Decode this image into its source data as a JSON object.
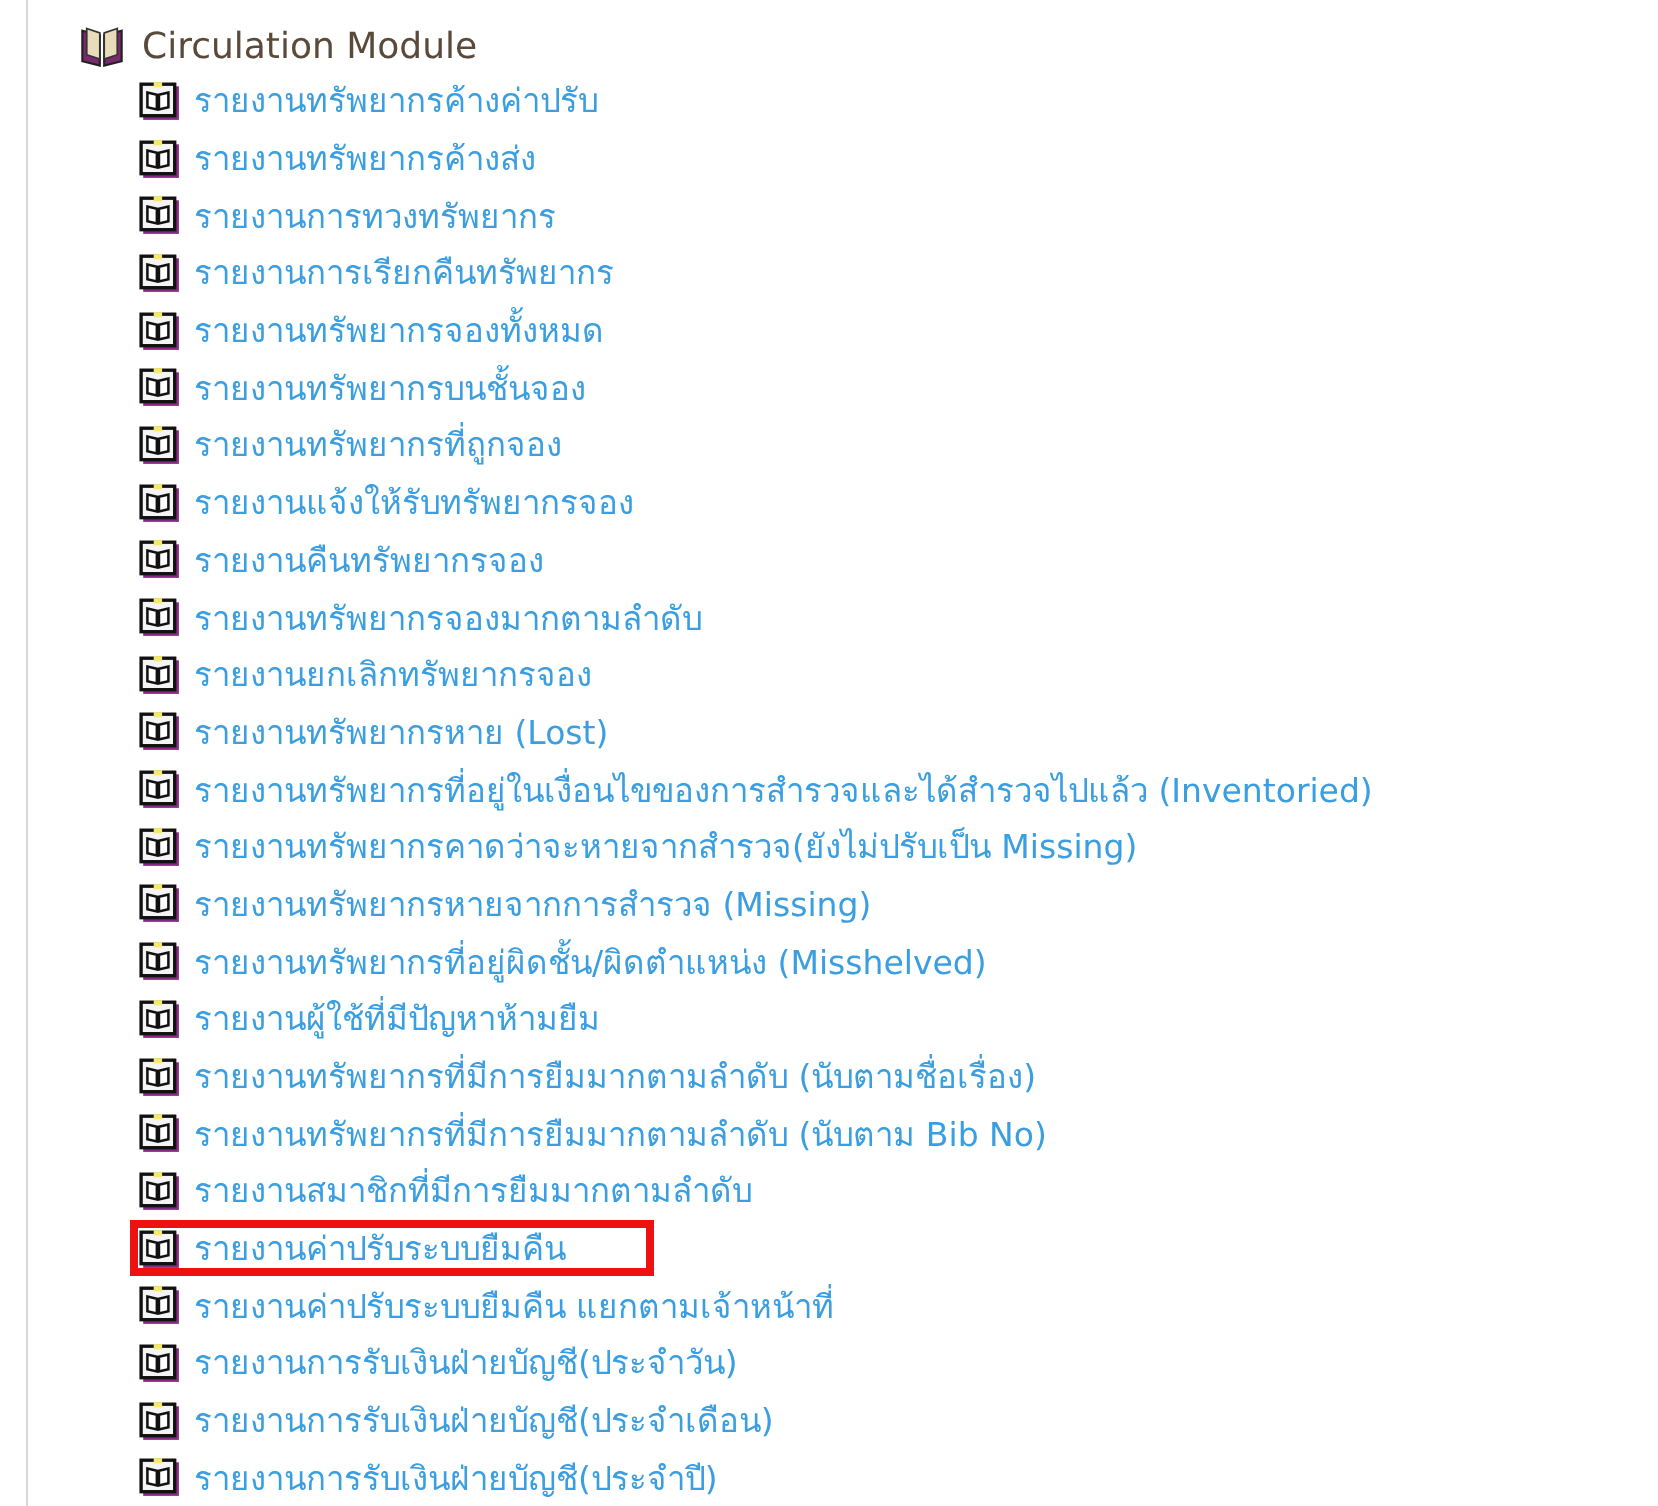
{
  "tree": {
    "label": "Circulation Module",
    "expanded": true,
    "children": [
      {
        "label": "รายงานทรัพยากรค้างค่าปรับ",
        "highlighted": false
      },
      {
        "label": "รายงานทรัพยากรค้างส่ง",
        "highlighted": false
      },
      {
        "label": "รายงานการทวงทรัพยากร",
        "highlighted": false
      },
      {
        "label": "รายงานการเรียกคืนทรัพยากร",
        "highlighted": false
      },
      {
        "label": "รายงานทรัพยากรจองทั้งหมด",
        "highlighted": false
      },
      {
        "label": "รายงานทรัพยากรบนชั้นจอง",
        "highlighted": false
      },
      {
        "label": "รายงานทรัพยากรที่ถูกจอง",
        "highlighted": false
      },
      {
        "label": "รายงานแจ้งให้รับทรัพยากรจอง",
        "highlighted": false
      },
      {
        "label": "รายงานคืนทรัพยากรจอง",
        "highlighted": false
      },
      {
        "label": "รายงานทรัพยากรจองมากตามลำดับ",
        "highlighted": false
      },
      {
        "label": "รายงานยกเลิกทรัพยากรจอง",
        "highlighted": false
      },
      {
        "label": "รายงานทรัพยากรหาย (Lost)",
        "highlighted": false
      },
      {
        "label": "รายงานทรัพยากรที่อยู่ในเงื่อนไขของการสำรวจและได้สำรวจไปแล้ว (Inventoried)",
        "highlighted": false
      },
      {
        "label": "รายงานทรัพยากรคาดว่าจะหายจากสำรวจ(ยังไม่ปรับเป็น Missing)",
        "highlighted": false
      },
      {
        "label": "รายงานทรัพยากรหายจากการสำรวจ (Missing)",
        "highlighted": false
      },
      {
        "label": "รายงานทรัพยากรที่อยู่ผิดชั้น/ผิดตำแหน่ง (Misshelved)",
        "highlighted": false
      },
      {
        "label": "รายงานผู้ใช้ที่มีปัญหาห้ามยืม",
        "highlighted": false
      },
      {
        "label": "รายงานทรัพยากรที่มีการยืมมากตามลำดับ (นับตามชื่อเรื่อง)",
        "highlighted": false
      },
      {
        "label": "รายงานทรัพยากรที่มีการยืมมากตามลำดับ (นับตาม Bib No)",
        "highlighted": false
      },
      {
        "label": "รายงานสมาชิกที่มีการยืมมากตามลำดับ",
        "highlighted": false
      },
      {
        "label": "รายงานค่าปรับระบบยืมคืน",
        "highlighted": true
      },
      {
        "label": "รายงานค่าปรับระบบยืมคืน แยกตามเจ้าหน้าที่",
        "highlighted": false
      },
      {
        "label": "รายงานการรับเงินฝ่ายบัญชี(ประจำวัน)",
        "highlighted": false
      },
      {
        "label": "รายงานการรับเงินฝ่ายบัญชี(ประจำเดือน)",
        "highlighted": false
      },
      {
        "label": "รายงานการรับเงินฝ่ายบัญชี(ประจำปี)",
        "highlighted": false
      }
    ]
  }
}
